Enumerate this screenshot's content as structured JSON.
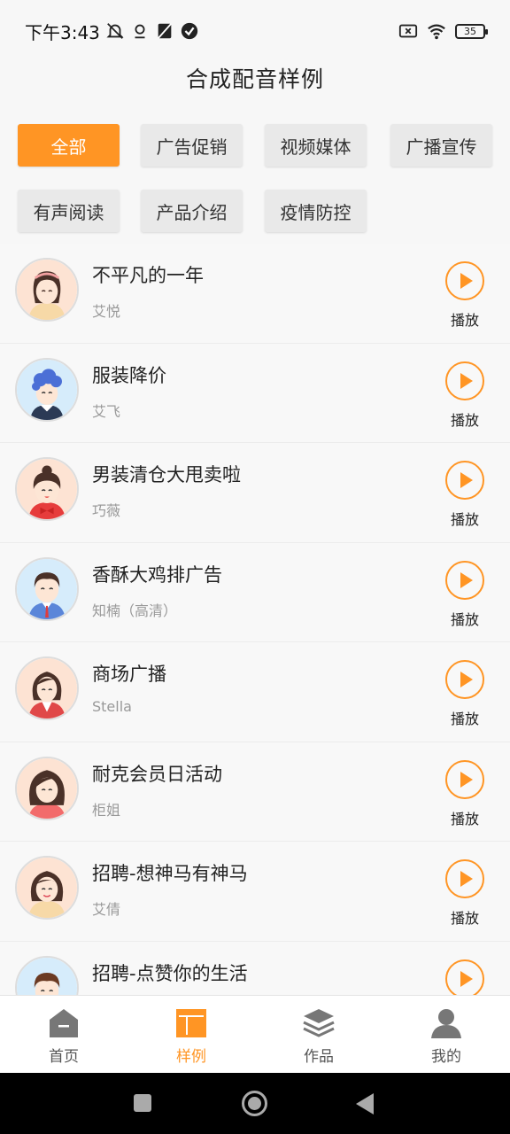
{
  "status": {
    "time": "下午3:43",
    "battery": "35"
  },
  "title": "合成配音样例",
  "filters": [
    {
      "label": "全部",
      "active": true
    },
    {
      "label": "广告促销",
      "active": false
    },
    {
      "label": "视频媒体",
      "active": false
    },
    {
      "label": "广播宣传",
      "active": false
    },
    {
      "label": "有声阅读",
      "active": false
    },
    {
      "label": "产品介绍",
      "active": false
    },
    {
      "label": "疫情防控",
      "active": false
    }
  ],
  "samples": [
    {
      "title": "不平凡的一年",
      "voice": "艾悦",
      "play": "播放",
      "avatar": "girl-bangs"
    },
    {
      "title": "服装降价",
      "voice": "艾飞",
      "play": "播放",
      "avatar": "boy-blue"
    },
    {
      "title": "男装清仓大甩卖啦",
      "voice": "巧薇",
      "play": "播放",
      "avatar": "girl-red-bow"
    },
    {
      "title": "香酥大鸡排广告",
      "voice": "知楠（高清）",
      "play": "播放",
      "avatar": "man-suit"
    },
    {
      "title": "商场广播",
      "voice": "Stella",
      "play": "播放",
      "avatar": "woman-red"
    },
    {
      "title": "耐克会员日活动",
      "voice": "柜姐",
      "play": "播放",
      "avatar": "woman-long-hair"
    },
    {
      "title": "招聘-想神马有神马",
      "voice": "艾倩",
      "play": "播放",
      "avatar": "girl-smile"
    },
    {
      "title": "招聘-点赞你的生活",
      "voice": "",
      "play": "播放",
      "avatar": "man-smile"
    }
  ],
  "tabs": [
    {
      "label": "首页",
      "icon": "home-icon",
      "active": false
    },
    {
      "label": "样例",
      "icon": "layout-icon",
      "active": true
    },
    {
      "label": "作品",
      "icon": "layers-icon",
      "active": false
    },
    {
      "label": "我的",
      "icon": "user-icon",
      "active": false
    }
  ],
  "colors": {
    "accent": "#ff9524",
    "tab_inactive": "#777777"
  }
}
